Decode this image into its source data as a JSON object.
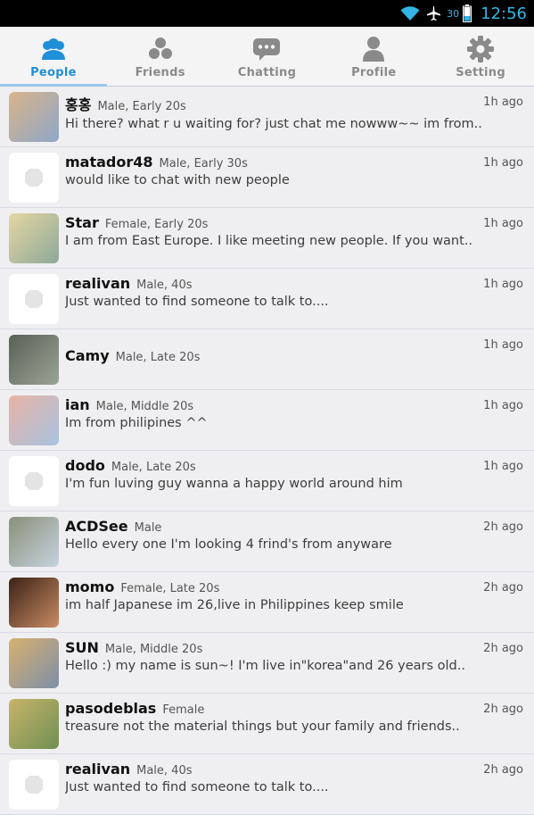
{
  "status_bar": {
    "battery_level": "30",
    "time": "12:56",
    "icons": [
      "wifi-icon",
      "airplane-icon",
      "battery-icon"
    ]
  },
  "tabs": [
    {
      "label": "People",
      "icon": "people-icon",
      "active": true
    },
    {
      "label": "Friends",
      "icon": "friends-icon",
      "active": false
    },
    {
      "label": "Chatting",
      "icon": "chat-bubble-icon",
      "active": false
    },
    {
      "label": "Profile",
      "icon": "profile-icon",
      "active": false
    },
    {
      "label": "Setting",
      "icon": "gear-icon",
      "active": false
    }
  ],
  "colors": {
    "accent": "#1f8fd9",
    "status_time": "#33b5e5",
    "background": "#efeff1"
  },
  "people": [
    {
      "name": "홍홍",
      "meta": "Male, Early 20s",
      "message": "Hi there? what r u waiting for? just chat me nowww~~ im from..",
      "time": "1h ago",
      "avatar": "photo",
      "c1": "#d9b48a",
      "c2": "#8ea7c8"
    },
    {
      "name": "matador48",
      "meta": "Male, Early 30s",
      "message": "would like to chat with new people",
      "time": "1h ago",
      "avatar": "placeholder"
    },
    {
      "name": "Star",
      "meta": "Female, Early 20s",
      "message": "I am from East Europe. I like meeting new people. If you want..",
      "time": "1h ago",
      "avatar": "photo",
      "c1": "#e3d6a2",
      "c2": "#8fa89a"
    },
    {
      "name": "realivan",
      "meta": "Male, 40s",
      "message": "Just wanted to find someone to talk to....",
      "time": "1h ago",
      "avatar": "placeholder"
    },
    {
      "name": "Camy",
      "meta": "Male, Late 20s",
      "message": "",
      "time": "1h ago",
      "avatar": "photo",
      "c1": "#5b5f57",
      "c2": "#9aa596"
    },
    {
      "name": "ian",
      "meta": "Male, Middle 20s",
      "message": "Im from philipines ^^",
      "time": "1h ago",
      "avatar": "photo",
      "c1": "#e8b3a6",
      "c2": "#a8c3e0"
    },
    {
      "name": "dodo",
      "meta": "Male, Late 20s",
      "message": "I'm fun luving guy wanna a happy world around him",
      "time": "1h ago",
      "avatar": "placeholder"
    },
    {
      "name": "ACDSee",
      "meta": "Male",
      "message": "Hello every one I'm looking 4 frind's from anyware",
      "time": "2h ago",
      "avatar": "photo",
      "c1": "#8a8f7a",
      "c2": "#c6d3de"
    },
    {
      "name": "momo",
      "meta": "Female, Late 20s",
      "message": "im half Japanese im 26,live in Philippines keep smile",
      "time": "2h ago",
      "avatar": "photo",
      "c1": "#3b2216",
      "c2": "#c98b63"
    },
    {
      "name": "SUN",
      "meta": "Male, Middle 20s",
      "message": "Hello :) my name is sun~! I'm live in\"korea\"and 26 years old..",
      "time": "2h ago",
      "avatar": "photo",
      "c1": "#d8b06f",
      "c2": "#7d8fa8"
    },
    {
      "name": "pasodeblas",
      "meta": "Female",
      "message": "treasure not the material things but your family and friends..",
      "time": "2h ago",
      "avatar": "photo",
      "c1": "#c7b46a",
      "c2": "#6f8f52"
    },
    {
      "name": "realivan",
      "meta": "Male, 40s",
      "message": "Just wanted to find someone to talk to....",
      "time": "2h ago",
      "avatar": "placeholder"
    }
  ]
}
